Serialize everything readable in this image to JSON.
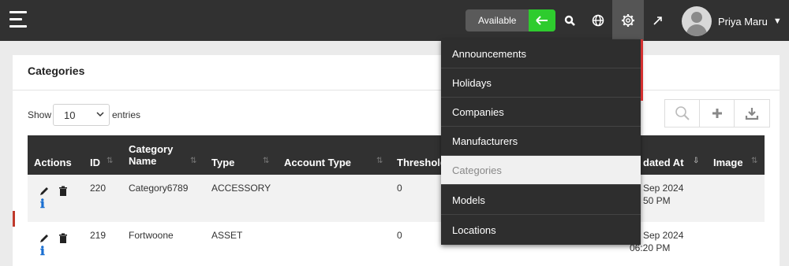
{
  "topbar": {
    "availability": "Available",
    "user_name": "Priya Maru",
    "icons": [
      "menu-icon",
      "arrow-left-icon",
      "search-icon",
      "globe-icon",
      "gear-icon",
      "rocket-icon",
      "avatar",
      "caret-down-icon"
    ],
    "colors": {
      "bar": "#313131",
      "available_go": "#2ecc2e"
    }
  },
  "panel": {
    "title": "Categories",
    "show_label": "Show",
    "entries_value": "10",
    "entries_label": "entries"
  },
  "table": {
    "headers": [
      "Actions",
      "ID",
      "Category Name",
      "Type",
      "Account Type",
      "Threshold",
      "dated At",
      "Image"
    ],
    "rows": [
      {
        "id": "220",
        "name": "Category6789",
        "type": "ACCESSORY",
        "threshold": "0",
        "updated_1": "Sep 2024",
        "updated_2": "50 PM"
      },
      {
        "id": "219",
        "name": "Fortwoone",
        "type": "ASSET",
        "threshold": "0",
        "updated_1": "Sep 2024",
        "updated_2": "06:20 PM"
      }
    ]
  },
  "menu": {
    "items": [
      "Announcements",
      "Holidays",
      "Companies",
      "Manufacturers",
      "Categories",
      "Models",
      "Locations"
    ],
    "active": "Categories"
  }
}
